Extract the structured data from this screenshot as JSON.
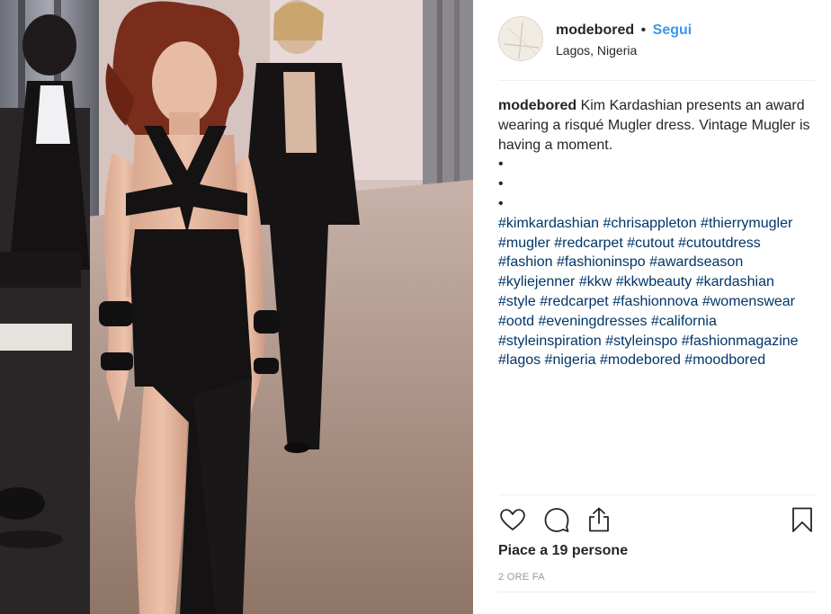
{
  "post": {
    "username": "modebored",
    "separator": "•",
    "follow_label": "Segui",
    "location": "Lagos, Nigeria",
    "caption_user": "modebored",
    "caption_text": "Kim Kardashian presents an award wearing a risqué Mugler dress. Vintage Mugler is having a moment.",
    "bullets": [
      "•",
      "•",
      "•"
    ],
    "hashtags": [
      "#kimkardashian",
      "#chrisappleton",
      "#thierrymugler",
      "#mugler",
      "#redcarpet",
      "#cutout",
      "#cutoutdress",
      "#fashion",
      "#fashioninspo",
      "#awardseason",
      "#kyliejenner",
      "#kkw",
      "#kkwbeauty",
      "#kardashian",
      "#style",
      "#redcarpet",
      "#fashionnova",
      "#womenswear",
      "#ootd",
      "#eveningdresses",
      "#california",
      "#styleinspiration",
      "#styleinspo",
      "#fashionmagazine",
      "#lagos",
      "#nigeria",
      "#modebored",
      "#moodbored"
    ],
    "likes_label": "Piace a 19 persone",
    "time_label": "2 ORE FA"
  },
  "actions": {
    "like_icon": "heart-icon",
    "comment_icon": "comment-icon",
    "share_icon": "share-icon",
    "save_icon": "bookmark-icon"
  },
  "colors": {
    "link": "#3897f0",
    "hashtag": "#003569",
    "text": "#262626",
    "muted": "#999999"
  }
}
